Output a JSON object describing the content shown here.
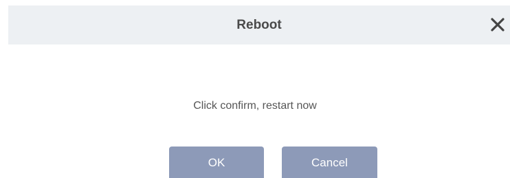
{
  "dialog": {
    "title": "Reboot",
    "close_icon": "close-icon",
    "message": "Click confirm, restart now",
    "ok_label": "OK",
    "cancel_label": "Cancel"
  },
  "colors": {
    "title_bar_bg": "#edf0f3",
    "button_bg": "#8d9ab8",
    "button_text": "#ffffff",
    "title_text": "#4a4a4a",
    "message_text": "#555555"
  }
}
